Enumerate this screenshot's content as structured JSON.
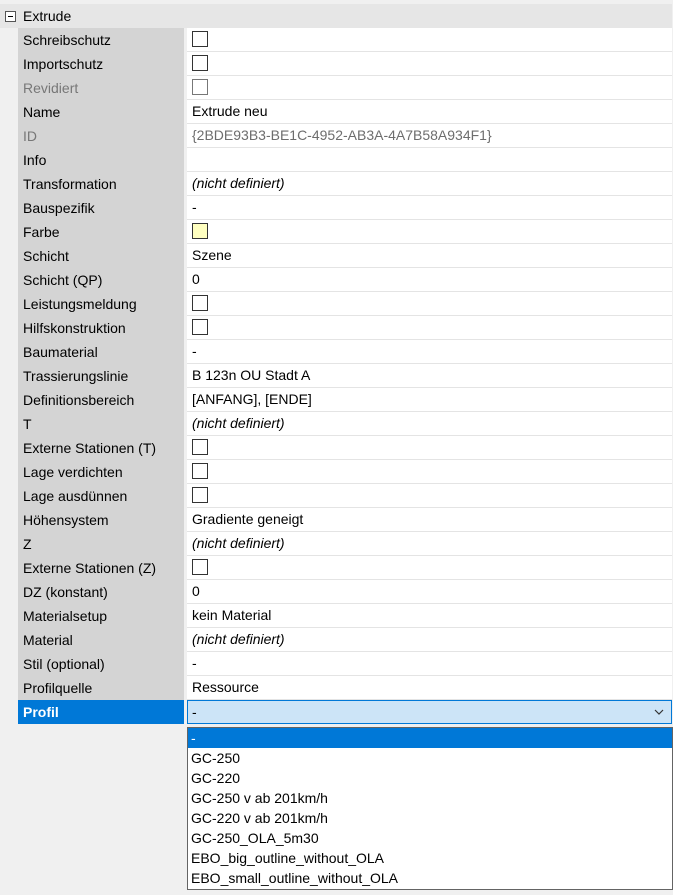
{
  "category": {
    "title": "Extrude"
  },
  "properties": [
    {
      "label": "Schreibschutz",
      "kind": "checkbox"
    },
    {
      "label": "Importschutz",
      "kind": "checkbox"
    },
    {
      "label": "Revidiert",
      "kind": "checkbox",
      "disabled": true
    },
    {
      "label": "Name",
      "kind": "text",
      "value": "Extrude neu"
    },
    {
      "label": "ID",
      "kind": "text",
      "value": "{2BDE93B3-BE1C-4952-AB3A-4A7B58A934F1}",
      "disabled": true
    },
    {
      "label": "Info",
      "kind": "text",
      "value": ""
    },
    {
      "label": "Transformation",
      "kind": "text",
      "value": "(nicht definiert)",
      "italic": true
    },
    {
      "label": "Bauspezifik",
      "kind": "text",
      "value": "-"
    },
    {
      "label": "Farbe",
      "kind": "color",
      "color": "#ffffc0"
    },
    {
      "label": "Schicht",
      "kind": "text",
      "value": "Szene"
    },
    {
      "label": "Schicht (QP)",
      "kind": "text",
      "value": "0"
    },
    {
      "label": "Leistungsmeldung",
      "kind": "checkbox"
    },
    {
      "label": "Hilfskonstruktion",
      "kind": "checkbox"
    },
    {
      "label": "Baumaterial",
      "kind": "text",
      "value": "-"
    },
    {
      "label": "Trassierungslinie",
      "kind": "text",
      "value": "B 123n OU Stadt A"
    },
    {
      "label": "Definitionsbereich",
      "kind": "text",
      "value": "[ANFANG], [ENDE]"
    },
    {
      "label": "T",
      "kind": "text",
      "value": "(nicht definiert)",
      "italic": true
    },
    {
      "label": "Externe Stationen (T)",
      "kind": "checkbox"
    },
    {
      "label": "Lage verdichten",
      "kind": "checkbox"
    },
    {
      "label": "Lage ausdünnen",
      "kind": "checkbox"
    },
    {
      "label": "Höhensystem",
      "kind": "text",
      "value": "Gradiente geneigt"
    },
    {
      "label": "Z",
      "kind": "text",
      "value": "(nicht definiert)",
      "italic": true
    },
    {
      "label": "Externe Stationen (Z)",
      "kind": "checkbox"
    },
    {
      "label": "DZ (konstant)",
      "kind": "text",
      "value": "0"
    },
    {
      "label": "Materialsetup",
      "kind": "text",
      "value": "kein Material"
    },
    {
      "label": "Material",
      "kind": "text",
      "value": "(nicht definiert)",
      "italic": true
    },
    {
      "label": "Stil (optional)",
      "kind": "text",
      "value": "-"
    },
    {
      "label": "Profilquelle",
      "kind": "text",
      "value": "Ressource"
    }
  ],
  "selected_property": {
    "label": "Profil",
    "value": "-",
    "options": [
      "-",
      "GC-250",
      "GC-220",
      "GC-250 v ab 201km/h",
      "GC-220 v ab 201km/h",
      "GC-250_OLA_5m30",
      "EBO_big_outline_without_OLA",
      "EBO_small_outline_without_OLA"
    ],
    "highlighted_index": 0
  },
  "colors": {
    "selection": "#0078d7",
    "select_background": "#cce4f7",
    "label_background": "#d4d4d4"
  }
}
